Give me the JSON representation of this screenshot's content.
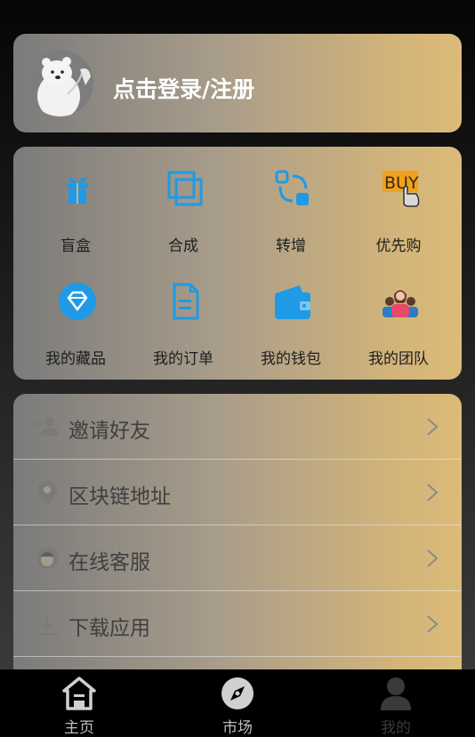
{
  "profile": {
    "login_text": "点击登录/注册",
    "avatar_icon": "polar-bear-avatar"
  },
  "shortcuts": [
    {
      "label": "盲盒",
      "icon": "gift-icon"
    },
    {
      "label": "合成",
      "icon": "layers-icon"
    },
    {
      "label": "转增",
      "icon": "transfer-icon"
    },
    {
      "label": "优先购",
      "icon": "buy-icon"
    },
    {
      "label": "我的藏品",
      "icon": "diamond-icon"
    },
    {
      "label": "我的订单",
      "icon": "document-icon"
    },
    {
      "label": "我的钱包",
      "icon": "wallet-icon"
    },
    {
      "label": "我的团队",
      "icon": "team-icon"
    }
  ],
  "menu": [
    {
      "label": "邀请好友",
      "icon": "add-user-icon"
    },
    {
      "label": "区块链地址",
      "icon": "location-pin-icon"
    },
    {
      "label": "在线客服",
      "icon": "support-agent-icon"
    },
    {
      "label": "下载应用",
      "icon": "download-icon"
    }
  ],
  "tabbar": [
    {
      "label": "主页",
      "icon": "home-icon"
    },
    {
      "label": "市场",
      "icon": "compass-icon"
    },
    {
      "label": "我的",
      "icon": "user-icon",
      "active": true
    }
  ],
  "colors": {
    "accent_blue": "#1e9ae6",
    "gold": "#dcbb78",
    "background": "#000000"
  }
}
